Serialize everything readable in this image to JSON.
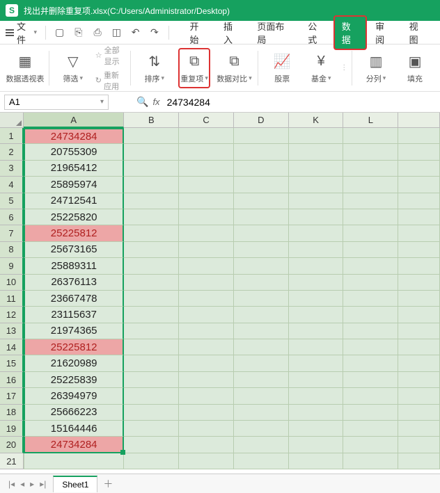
{
  "titlebar": {
    "logo": "S",
    "title": "找出并删除重复项.xlsx(C:/Users/Administrator/Desktop)"
  },
  "menubar": {
    "file": "文件",
    "tabs": [
      "开始",
      "插入",
      "页面布局",
      "公式",
      "数据",
      "审阅",
      "视图"
    ],
    "active_tab_index": 4
  },
  "ribbon": {
    "pivot": "数据透视表",
    "filter": "筛选",
    "showall": "全部显示",
    "reapply": "重新应用",
    "sort": "排序",
    "duplicates": "重复项",
    "compare": "数据对比",
    "stock": "股票",
    "fund": "基金",
    "split": "分列",
    "fill": "填充"
  },
  "formulabar": {
    "name": "A1",
    "fx": "fx",
    "value": "24734284"
  },
  "grid": {
    "columns": [
      "A",
      "B",
      "C",
      "D",
      "K",
      "L"
    ],
    "row_headers": [
      1,
      2,
      3,
      4,
      5,
      6,
      7,
      8,
      9,
      10,
      11,
      12,
      13,
      14,
      15,
      16,
      17,
      18,
      19,
      20,
      21
    ],
    "colA": [
      {
        "v": "24734284",
        "dup": true
      },
      {
        "v": "20755309",
        "dup": false
      },
      {
        "v": "21965412",
        "dup": false
      },
      {
        "v": "25895974",
        "dup": false
      },
      {
        "v": "24712541",
        "dup": false
      },
      {
        "v": "25225820",
        "dup": false
      },
      {
        "v": "25225812",
        "dup": true
      },
      {
        "v": "25673165",
        "dup": false
      },
      {
        "v": "25889311",
        "dup": false
      },
      {
        "v": "26376113",
        "dup": false
      },
      {
        "v": "23667478",
        "dup": false
      },
      {
        "v": "23115637",
        "dup": false
      },
      {
        "v": "21974365",
        "dup": false
      },
      {
        "v": "25225812",
        "dup": true
      },
      {
        "v": "21620989",
        "dup": false
      },
      {
        "v": "25225839",
        "dup": false
      },
      {
        "v": "26394979",
        "dup": false
      },
      {
        "v": "25666223",
        "dup": false
      },
      {
        "v": "15164446",
        "dup": false
      },
      {
        "v": "24734284",
        "dup": true
      }
    ]
  },
  "sheettabs": {
    "active": "Sheet1"
  }
}
